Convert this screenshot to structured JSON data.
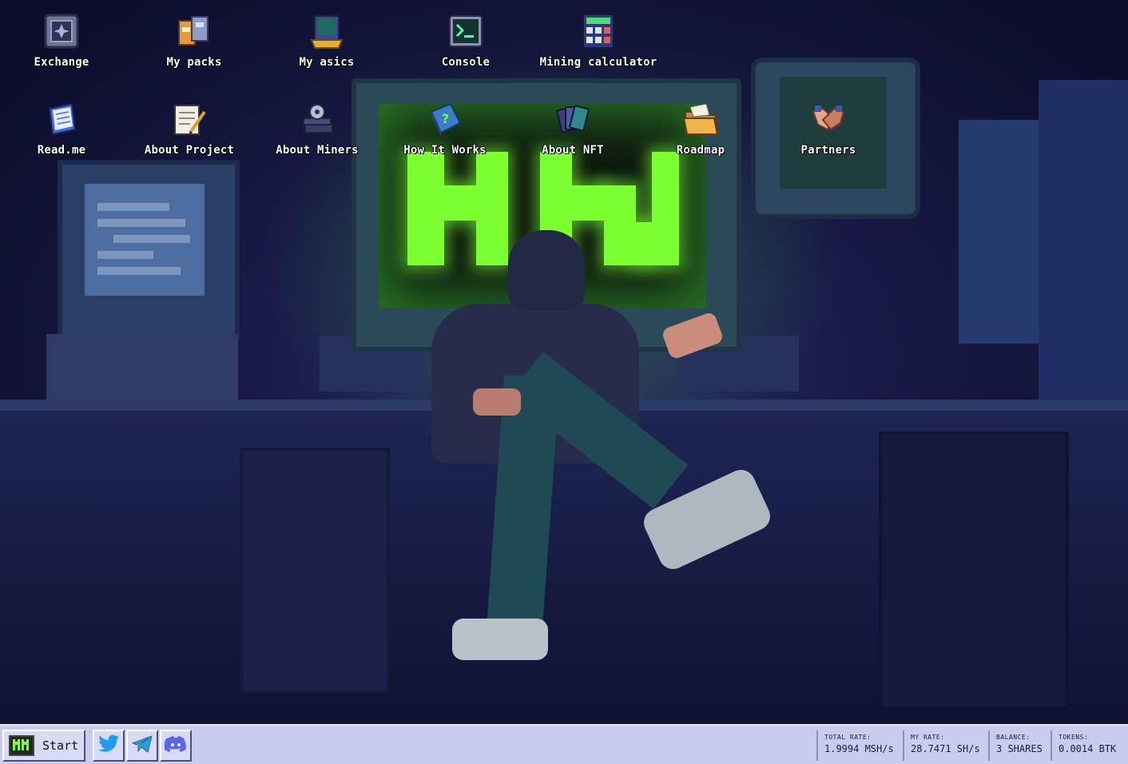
{
  "desktop": {
    "icons": [
      {
        "label": "Exchange",
        "icon": "exchange-icon"
      },
      {
        "label": "My packs",
        "icon": "packs-icon"
      },
      {
        "label": "My asics",
        "icon": "asics-icon"
      },
      {
        "label": "Console",
        "icon": "console-icon"
      },
      {
        "label": "Mining calculator",
        "icon": "calculator-icon"
      },
      {
        "label": "Read.me",
        "icon": "notebook-icon"
      },
      {
        "label": "About Project",
        "icon": "notepad-icon"
      },
      {
        "label": "About Miners",
        "icon": "miner-book-icon"
      },
      {
        "label": "How It Works",
        "icon": "help-book-icon"
      },
      {
        "label": "About NFT",
        "icon": "nft-cards-icon"
      },
      {
        "label": "Roadmap",
        "icon": "folder-icon"
      },
      {
        "label": "Partners",
        "icon": "handshake-icon"
      }
    ],
    "wallpaper_accent": "#7cff32"
  },
  "taskbar": {
    "start_label": "Start",
    "social": [
      {
        "name": "twitter",
        "icon": "twitter-icon",
        "color": "#1d9bf0"
      },
      {
        "name": "telegram",
        "icon": "telegram-icon",
        "color": "#2a9fd8"
      },
      {
        "name": "discord",
        "icon": "discord-icon",
        "color": "#5865f2"
      }
    ],
    "stats": {
      "total_rate": {
        "label": "TOTAL RATE:",
        "value": "1.9994 MSH/s"
      },
      "my_rate": {
        "label": "MY RATE:",
        "value": "28.7471 SH/s"
      },
      "balance": {
        "label": "BALANCE:",
        "value": "3 SHARES"
      },
      "tokens": {
        "label": "TOKENS:",
        "value": "0.0014 BTK"
      }
    }
  }
}
